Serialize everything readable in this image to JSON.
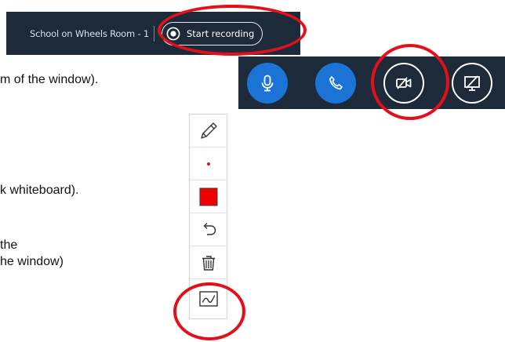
{
  "document": {
    "lines": [
      "m of the window).",
      "k whiteboard).",
      " the",
      "he window)"
    ]
  },
  "recording_bar": {
    "room_name": "School on Wheels Room - 1",
    "start_recording_label": "Start recording",
    "icon": "record-icon"
  },
  "media_controls": {
    "buttons": [
      {
        "icon": "microphone-icon",
        "style": "blue"
      },
      {
        "icon": "phone-icon",
        "style": "blue"
      },
      {
        "icon": "video-off-icon",
        "style": "outline"
      },
      {
        "icon": "screen-share-off-icon",
        "style": "outline"
      }
    ]
  },
  "whiteboard_toolbar": {
    "tools": [
      {
        "icon": "pencil-icon"
      },
      {
        "icon": "brush-size-dot-icon",
        "color": "#e3101a"
      },
      {
        "icon": "color-swatch-icon",
        "color": "#f00000"
      },
      {
        "icon": "undo-icon"
      },
      {
        "icon": "trash-icon"
      },
      {
        "icon": "multi-user-whiteboard-icon"
      }
    ]
  },
  "colors": {
    "bar_background": "#1d2a3a",
    "accent_blue": "#1b73d6",
    "highlight_red": "#e3101a"
  }
}
